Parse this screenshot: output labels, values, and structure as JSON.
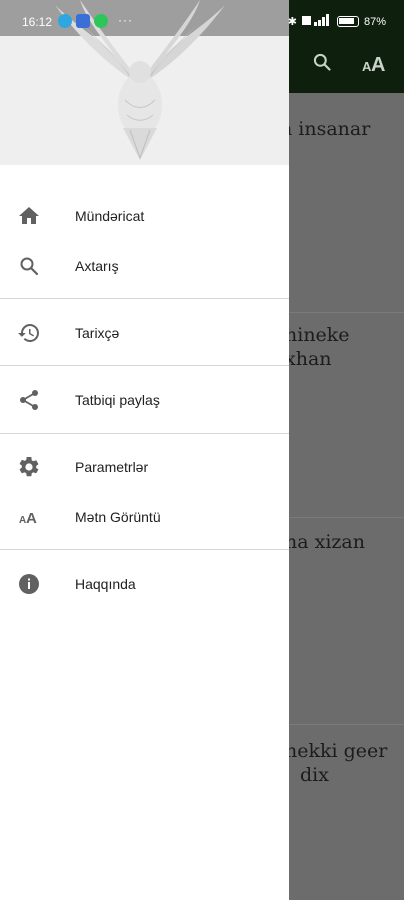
{
  "status_bar": {
    "time": "16:12",
    "more": "···",
    "battery": "87"
  },
  "background": {
    "card_titles": [
      "n insanar",
      "hineke",
      "xhan",
      "na xizan",
      "nekki geer",
      "dix"
    ]
  },
  "drawer": {
    "items": [
      {
        "label": "Mündəricat",
        "icon": "home-icon"
      },
      {
        "label": "Axtarış",
        "icon": "search-icon"
      },
      {
        "label": "Tarixçə",
        "icon": "history-icon"
      },
      {
        "label": "Tatbiqi paylaş",
        "icon": "share-icon"
      },
      {
        "label": "Parametrlər",
        "icon": "gear-icon"
      },
      {
        "label": "Mətn Görüntü",
        "icon": "text-size-icon"
      },
      {
        "label": "Haqqında",
        "icon": "info-icon"
      }
    ]
  },
  "colors": {
    "toolbar": "#0e1f0e",
    "drawer": "#ffffff",
    "icon": "#616161",
    "text": "#212121"
  }
}
